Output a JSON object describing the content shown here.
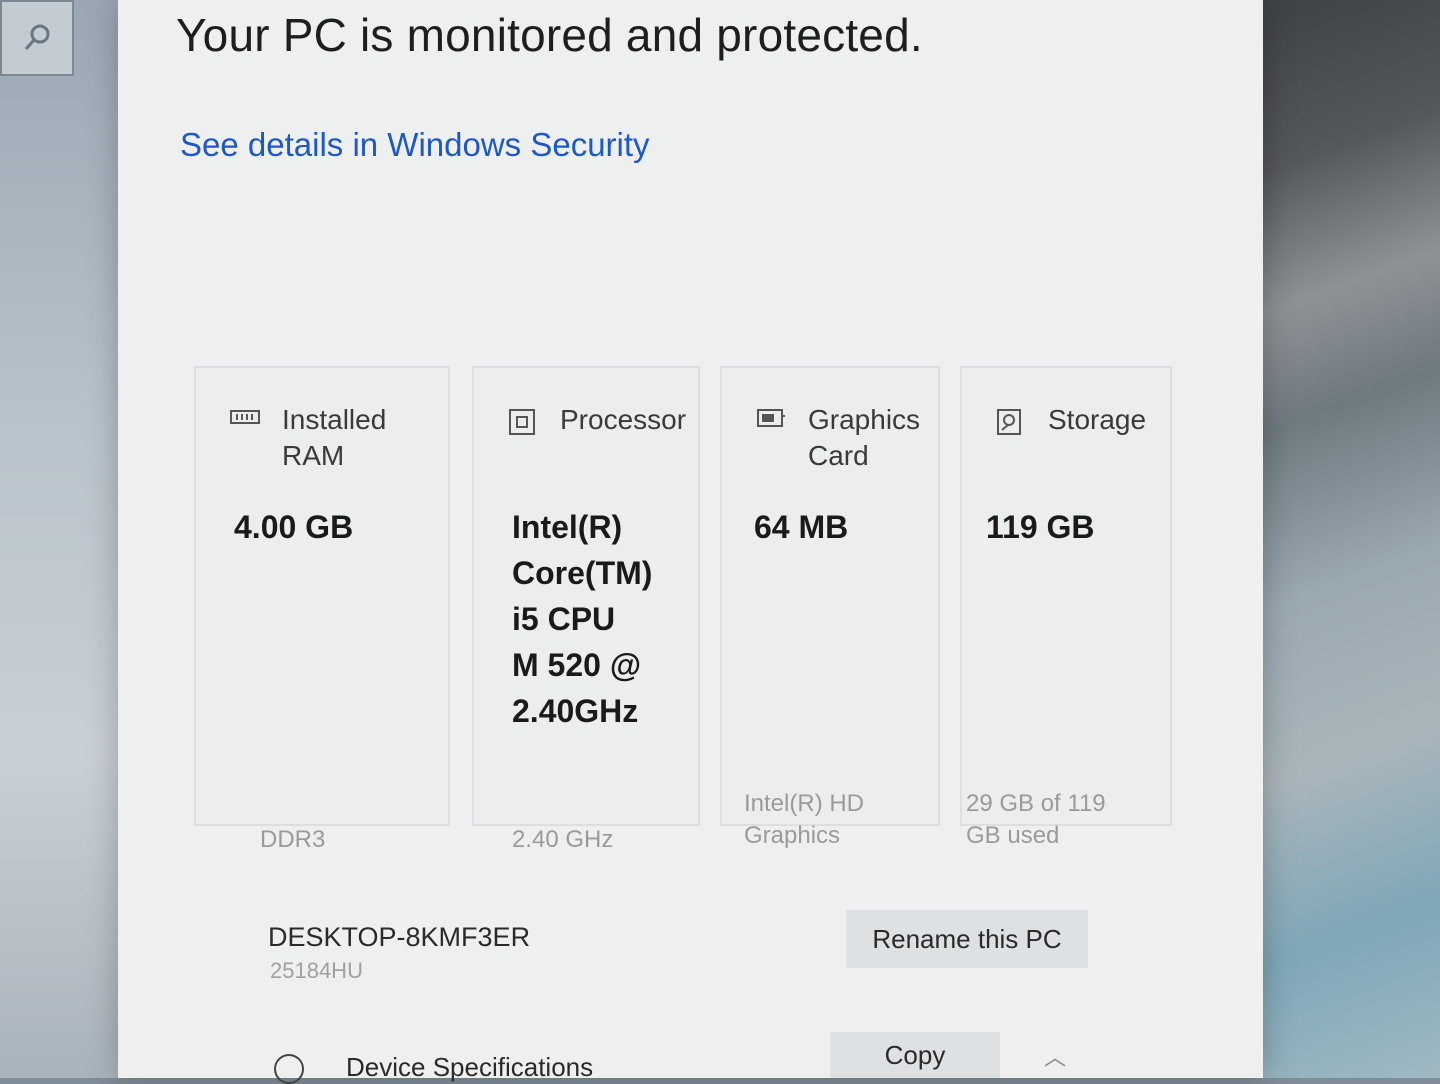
{
  "header": {
    "title": "Your PC is monitored and protected.",
    "security_link": "See details in Windows Security"
  },
  "cards": [
    {
      "icon": "ram-icon",
      "title": "Installed\nRAM",
      "value": "4.00 GB",
      "sub": "DDR3"
    },
    {
      "icon": "processor-icon",
      "title": "Processor",
      "value": "Intel(R)\nCore(TM)\ni5 CPU\nM 520 @\n2.40GHz",
      "sub": "2.40 GHz"
    },
    {
      "icon": "graphics-card-icon",
      "title": "Graphics\nCard",
      "value": "64 MB",
      "sub": "Intel(R) HD\nGraphics"
    },
    {
      "icon": "storage-icon",
      "title": "Storage",
      "value": "119 GB",
      "sub": "29 GB of 119\nGB used"
    }
  ],
  "device": {
    "name": "DESKTOP-8KMF3ER",
    "product_id": "25184HU",
    "rename_label": "Rename this PC"
  },
  "specs": {
    "label": "Device Specifications",
    "copy_label": "Copy"
  },
  "colors": {
    "link": "#1e58c8",
    "window_bg": "#eef0f0",
    "button_bg": "#dde1e4"
  }
}
